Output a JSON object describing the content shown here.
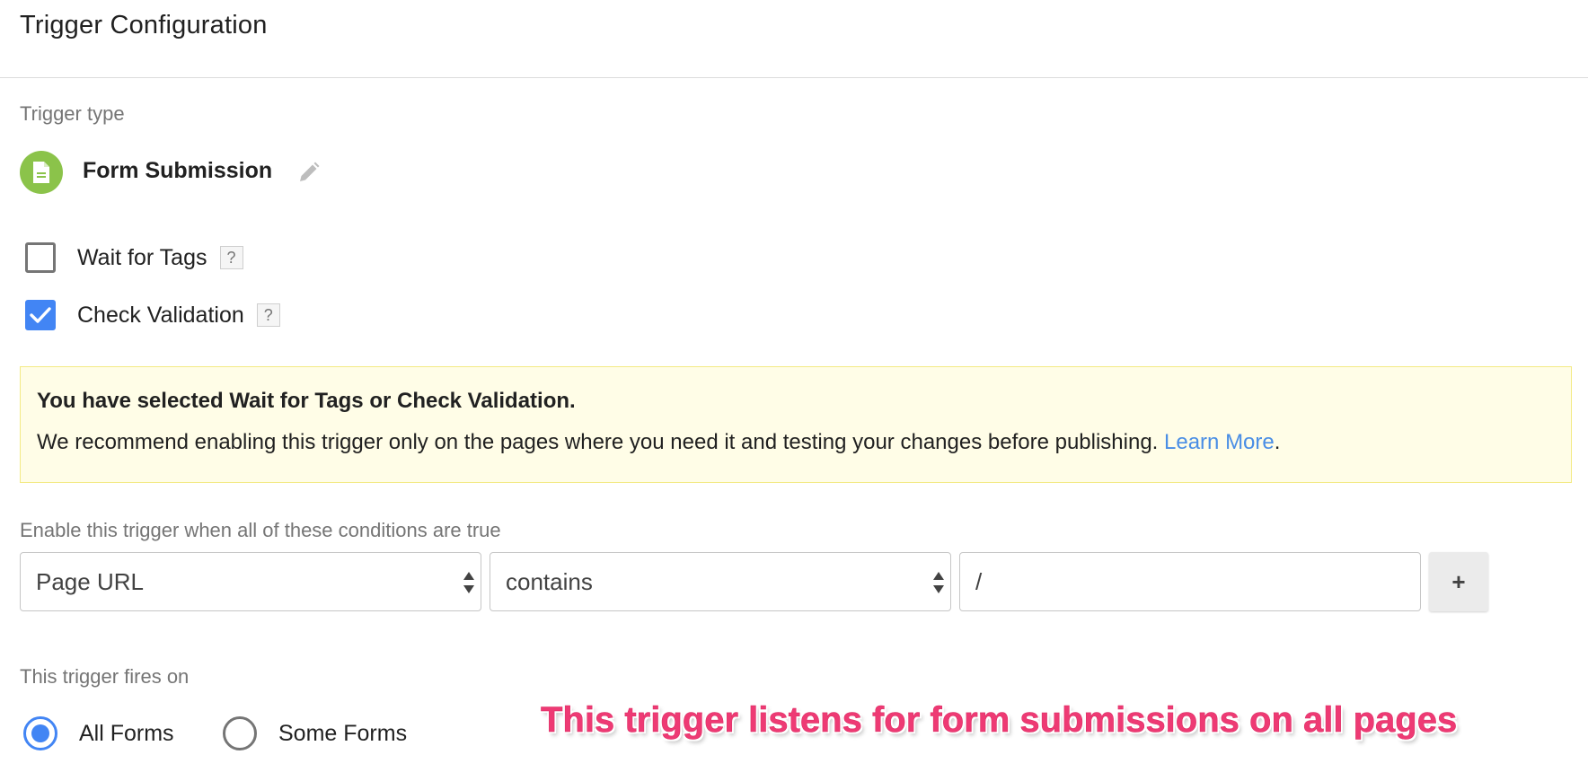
{
  "header": {
    "title": "Trigger Configuration"
  },
  "trigger_type": {
    "label": "Trigger type",
    "name": "Form Submission",
    "icon": "document-icon",
    "icon_color": "#8bc34a"
  },
  "options": [
    {
      "label": "Wait for Tags",
      "checked": false,
      "help": "?"
    },
    {
      "label": "Check Validation",
      "checked": true,
      "help": "?"
    }
  ],
  "notice": {
    "title": "You have selected Wait for Tags or Check Validation.",
    "body": "We recommend enabling this trigger only on the pages where you need it and testing your changes before publishing.",
    "link": "Learn More",
    "suffix": ".",
    "background": "#fffde7"
  },
  "conditions": {
    "label": "Enable this trigger when all of these conditions are true",
    "variable": "Page URL",
    "operator": "contains",
    "value": "/",
    "add_label": "+"
  },
  "fires_on": {
    "label": "This trigger fires on",
    "options": [
      {
        "label": "All Forms",
        "selected": true
      },
      {
        "label": "Some Forms",
        "selected": false
      }
    ]
  },
  "annotation": {
    "text": "This trigger listens for form submissions on all pages",
    "color": "#ee3a74"
  },
  "accent_color": "#4285f4"
}
